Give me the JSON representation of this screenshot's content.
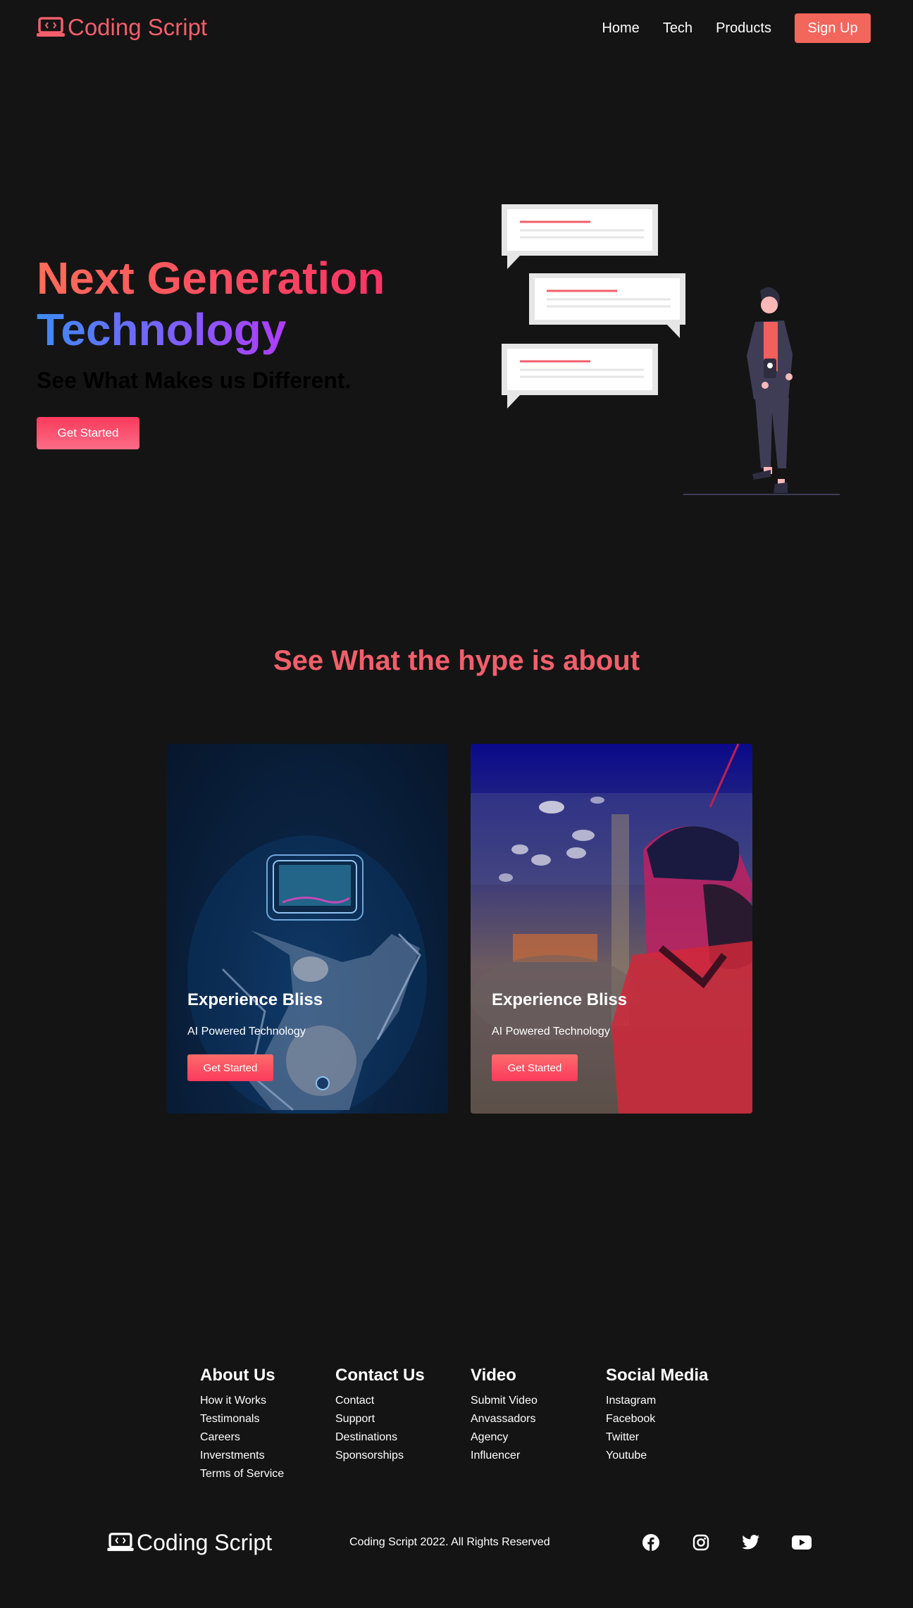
{
  "nav": {
    "brand": "Coding Script",
    "links": [
      "Home",
      "Tech",
      "Products"
    ],
    "signup": "Sign Up"
  },
  "hero": {
    "title_line1": "Next Generation",
    "title_line2": "Technology",
    "subtitle": "See What Makes us Different.",
    "cta": "Get Started"
  },
  "section": {
    "title": "See What the hype is about",
    "cards": [
      {
        "title": "Experience Bliss",
        "desc": "AI Powered Technology",
        "cta": "Get Started"
      },
      {
        "title": "Experience Bliss",
        "desc": "AI Powered Technology",
        "cta": "Get Started"
      }
    ]
  },
  "footer": {
    "columns": [
      {
        "heading": "About Us",
        "links": [
          "How it Works",
          "Testimonals",
          "Careers",
          "Inverstments",
          "Terms of Service"
        ]
      },
      {
        "heading": "Contact Us",
        "links": [
          "Contact",
          "Support",
          "Destinations",
          "Sponsorships"
        ]
      },
      {
        "heading": "Video",
        "links": [
          "Submit Video",
          "Anvassadors",
          "Agency",
          "Influencer"
        ]
      },
      {
        "heading": "Social Media",
        "links": [
          "Instagram",
          "Facebook",
          "Twitter",
          "Youtube"
        ]
      }
    ],
    "brand": "Coding Script",
    "copyright": "Coding Script 2022. All Rights Reserved",
    "social_icons": [
      "facebook-icon",
      "instagram-icon",
      "twitter-icon",
      "youtube-icon"
    ]
  },
  "colors": {
    "background": "#141414",
    "brand": "#f25f6b",
    "signup": "#f2665c",
    "gradient_warm": [
      "#ff6c59",
      "#fa3366"
    ],
    "gradient_cool": [
      "#3d8bf4",
      "#b13cff"
    ]
  }
}
